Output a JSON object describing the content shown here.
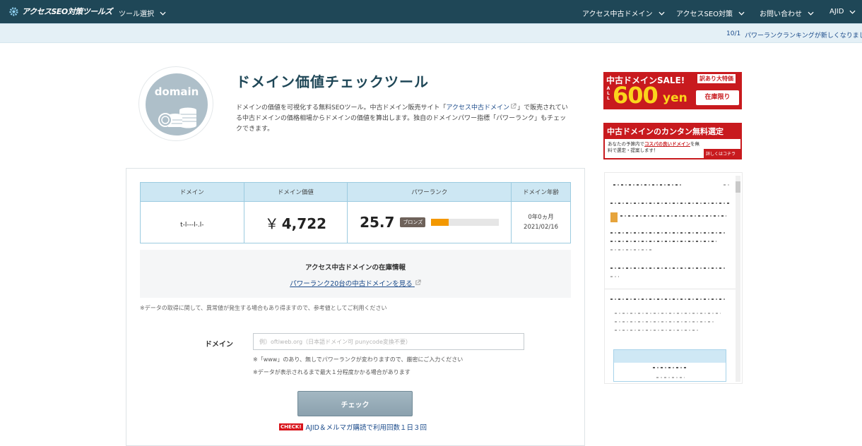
{
  "nav": {
    "logo": "アクセスSEO対策ツールズ",
    "tool_select": "ツール選択",
    "used_domains": "アクセス中古ドメイン",
    "seo": "アクセスSEO対策",
    "contact": "お問い合わせ",
    "ajid": "AJID"
  },
  "ticker": {
    "date": "10/1",
    "message": "パワーランクランキングが新しくなりました"
  },
  "hero": {
    "icon_word": "domain",
    "title": "ドメイン価値チェックツール",
    "desc_before": "ドメインの価値を可視化する無料SEOツール。中古ドメイン販売サイト「",
    "desc_link": "アクセス中古ドメイン",
    "desc_after": "」で販売されている中古ドメインの価格相場からドメインの価値を算出します。独自のドメインパワー指標「パワーランク」もチェックできます。"
  },
  "result": {
    "headers": [
      "ドメイン",
      "ドメイン価値",
      "パワーランク",
      "ドメイン年齢"
    ],
    "domain": "t-l---l-.l-",
    "value_symbol": "￥",
    "value": "4,722",
    "power_rank": "25.7",
    "rank_badge": "ブロンズ",
    "rank_fraction": 0.257,
    "age": "0年0ヵ月",
    "registered": "2021/02/16",
    "accent_color": "#f39800"
  },
  "stock": {
    "heading": "アクセス中古ドメインの在庫情報",
    "link": "パワーランク20台の中古ドメインを見る"
  },
  "form": {
    "data_note": "※データの取得に関して、異常値が発生する場合もあり得ますので、参考値としてご利用ください",
    "label": "ドメイン",
    "placeholder": "例）oftiweb.org（日本語ドメイン可 punycode変換不要）",
    "hint1": "※「www」のあり、無しでパワーランクが変わりますので、厳密にご入力ください",
    "hint2": "※データが表示されるまで最大１分程度かかる場合があります",
    "button": "チェック",
    "check_tag": "CHECK!",
    "check_note": "AJID＆メルマガ購読で利用回数１日３回"
  },
  "ads": {
    "sale_title": "中古ドメインSALE!",
    "sale_tag": "訳あり大特価",
    "sale_all": "A L L",
    "sale_price": "600",
    "sale_unit": "yen",
    "sale_stock": "在庫限り",
    "sel_title": "中古ドメインのカンタン無料選定",
    "sel_sub_1": "あなたの予算内で",
    "sel_sub_em": "コスパの良いドメイン",
    "sel_sub_2": "を無料で選定・提案します！",
    "sel_more": "詳しくはコチラ ＞"
  }
}
